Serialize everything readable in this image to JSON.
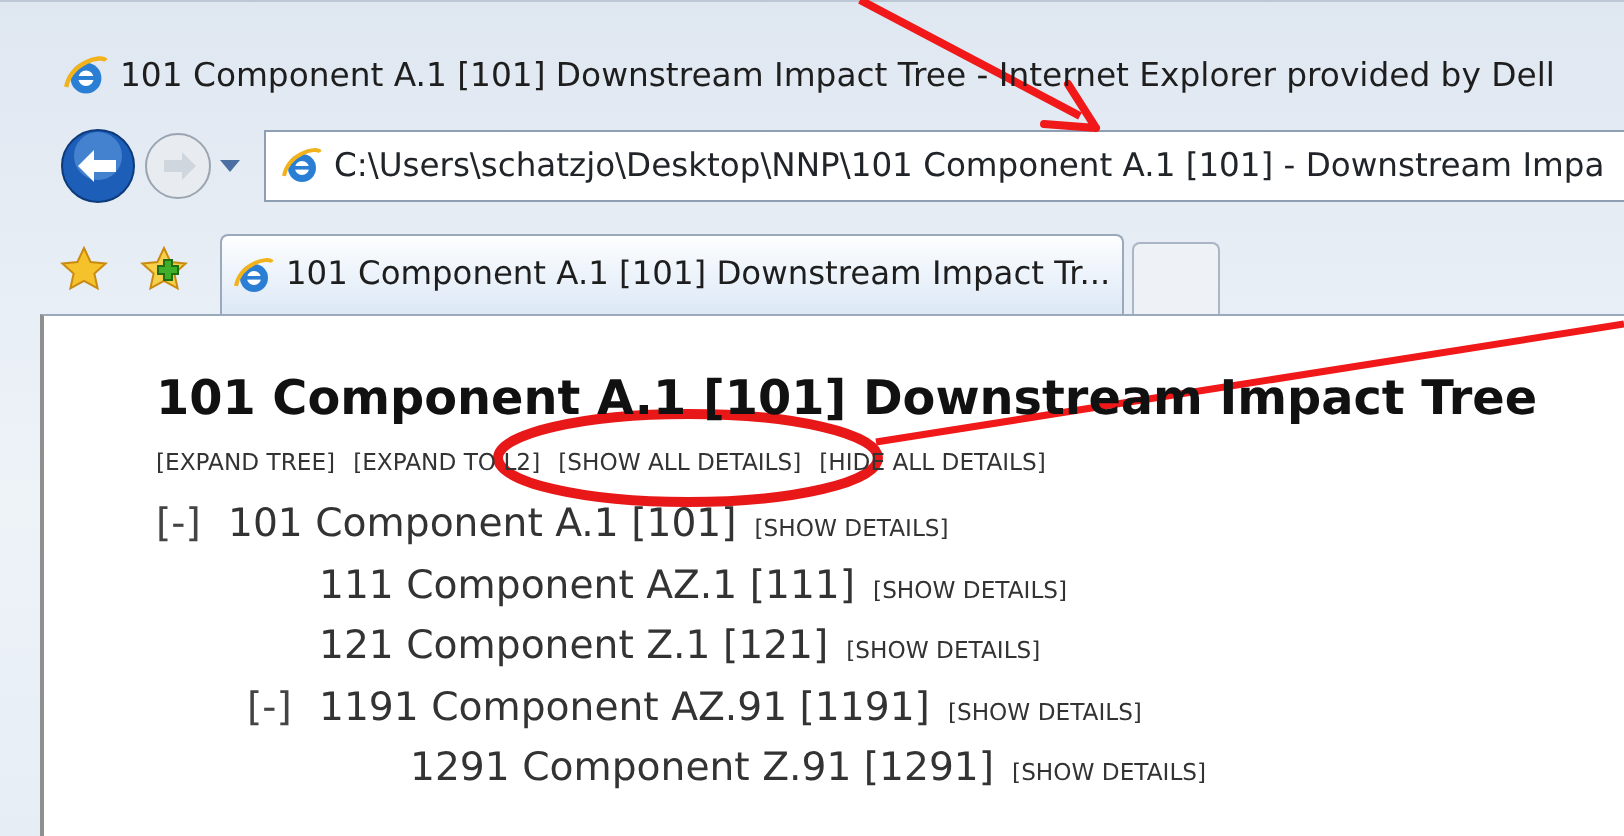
{
  "window": {
    "title": "101 Component A.1 [101] Downstream Impact Tree - Internet Explorer provided by Dell"
  },
  "address_bar": {
    "value": "C:\\Users\\schatzjo\\Desktop\\NNP\\101 Component A.1 [101] - Downstream Impa"
  },
  "tabs": [
    {
      "label": "101 Component A.1 [101] Downstream Impact Tr...",
      "selected": true
    }
  ],
  "page": {
    "heading": "101 Component A.1 [101] Downstream Impact Tree",
    "actions": [
      "[EXPAND TREE]",
      "[EXPAND TO L2]",
      "[SHOW ALL DETAILS]",
      "[HIDE ALL DETAILS]"
    ],
    "tree": [
      {
        "toggle": "[-]",
        "label": "101 Component A.1 [101]",
        "link": "[SHOW DETAILS]",
        "children": [
          {
            "label": "111 Component AZ.1 [111]",
            "link": "[SHOW DETAILS]"
          },
          {
            "label": "121 Component Z.1 [121]",
            "link": "[SHOW DETAILS]"
          },
          {
            "toggle": "[-]",
            "label": "1191 Component AZ.91 [1191]",
            "link": "[SHOW DETAILS]",
            "children": [
              {
                "label": "1291 Component Z.91 [1291]",
                "link": "[SHOW DETAILS]"
              }
            ]
          }
        ]
      }
    ]
  }
}
